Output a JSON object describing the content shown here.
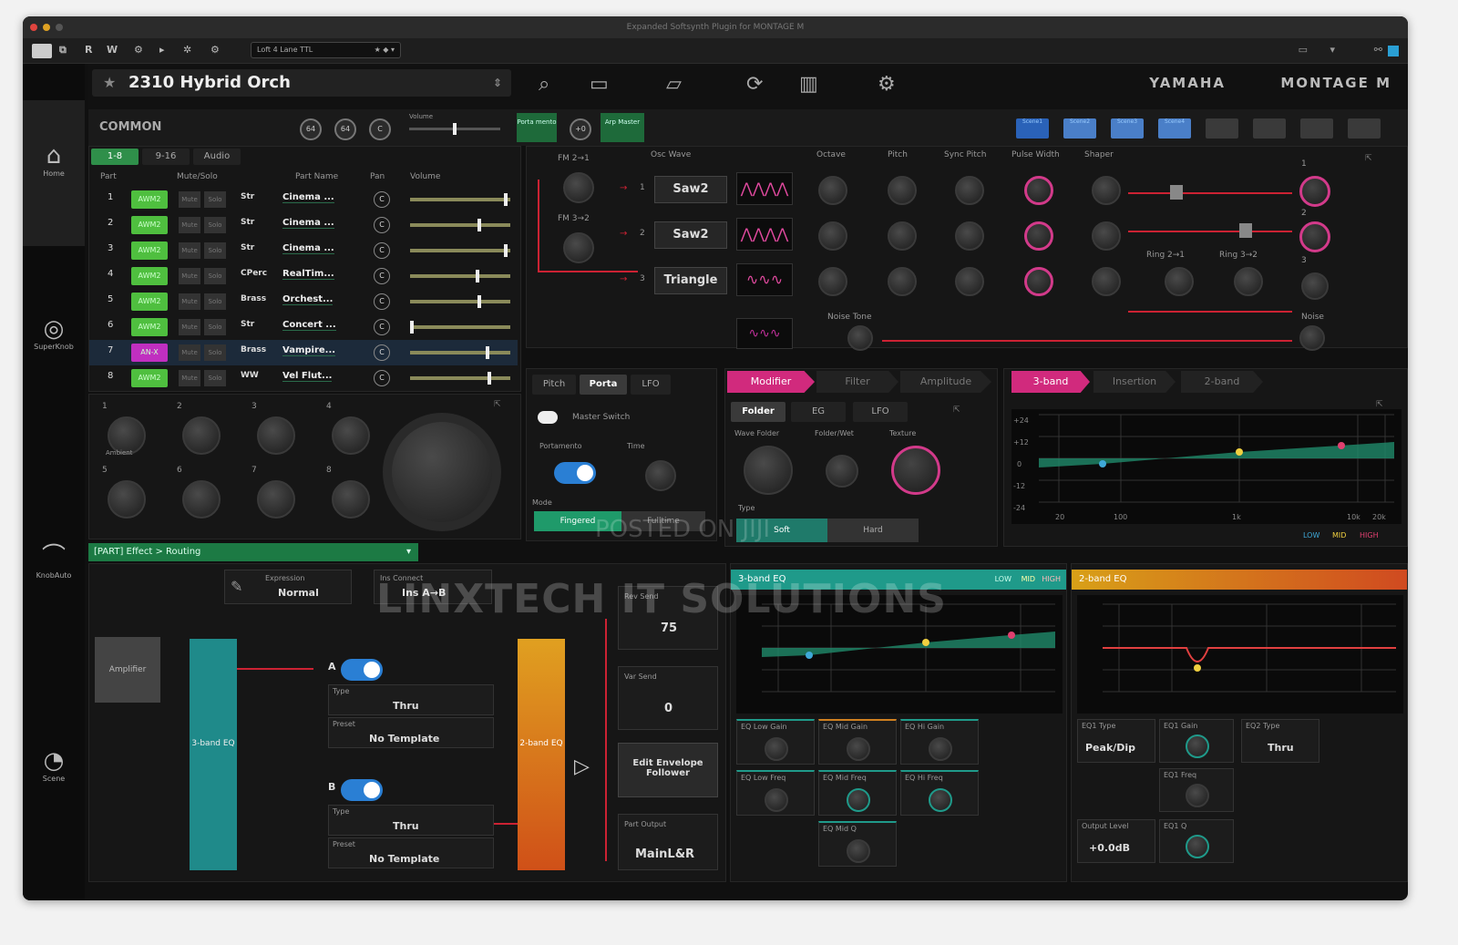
{
  "window": {
    "title": "Expanded Softsynth Plugin for MONTAGE M"
  },
  "toolbar": {
    "buttons": [
      "R",
      "W"
    ],
    "host_preset": "Loft 4 Lane TTL"
  },
  "header": {
    "preset_name": "2310 Hybrid Orch",
    "brand": "YAMAHA",
    "product": "MONTAGE M"
  },
  "sidebar": {
    "items": [
      "Home",
      "SuperKnob",
      "KnobAuto",
      "Scene"
    ]
  },
  "common": {
    "label": "COMMON",
    "pan": "64",
    "vol": "64",
    "porta_label": "Porta mento",
    "porta_value": "+0",
    "arp_label": "Arp Master",
    "vol_label": "Volume",
    "scenes": [
      "Scene1",
      "Scene2",
      "Scene3",
      "Scene4"
    ]
  },
  "parts": {
    "tabs": [
      "1-8",
      "9-16",
      "Audio"
    ],
    "headers": [
      "Part",
      "Mute/Solo",
      "Part Name",
      "Pan",
      "Volume"
    ],
    "rows": [
      {
        "num": "1",
        "type": "AWM2",
        "cat": "Str",
        "name": "Cinema ...",
        "pan": "C",
        "vol": 0.97
      },
      {
        "num": "2",
        "type": "AWM2",
        "cat": "Str",
        "name": "Cinema ...",
        "pan": "C",
        "vol": 0.7
      },
      {
        "num": "3",
        "type": "AWM2",
        "cat": "Str",
        "name": "Cinema ...",
        "pan": "C",
        "vol": 0.97
      },
      {
        "num": "4",
        "type": "AWM2",
        "cat": "CPerc",
        "name": "RealTim...",
        "pan": "C",
        "vol": 0.68
      },
      {
        "num": "5",
        "type": "AWM2",
        "cat": "Brass",
        "name": "Orchest...",
        "pan": "C",
        "vol": 0.7
      },
      {
        "num": "6",
        "type": "AWM2",
        "cat": "Str",
        "name": "Concert ...",
        "pan": "C",
        "vol": 0.0
      },
      {
        "num": "7",
        "type": "AN-X",
        "cat": "Brass",
        "name": "Vampire...",
        "pan": "C",
        "vol": 0.78
      },
      {
        "num": "8",
        "type": "AWM2",
        "cat": "WW",
        "name": "Vel Flut...",
        "pan": "C",
        "vol": 0.8
      }
    ],
    "mute": "Mute",
    "solo": "Solo"
  },
  "assign": {
    "knobs": [
      "1",
      "2",
      "3",
      "4",
      "5",
      "6",
      "7",
      "8"
    ],
    "knob1_label": "Ambient"
  },
  "osc": {
    "fm_labels": [
      "FM 2→1",
      "FM 3→2"
    ],
    "headers": [
      "Osc Wave",
      "Octave",
      "Pitch",
      "Sync Pitch",
      "Pulse Width",
      "Shaper"
    ],
    "osc_nums": [
      "1",
      "2",
      "3"
    ],
    "waves": [
      "Saw2",
      "Saw2",
      "Triangle"
    ],
    "ring_labels": [
      "Ring 2→1",
      "Ring 3→2"
    ],
    "noise_tone": "Noise Tone",
    "noise": "Noise",
    "out_nums": [
      "1",
      "2",
      "3"
    ]
  },
  "pitch_panel": {
    "tabs": [
      "Pitch",
      "Porta",
      "LFO"
    ],
    "master_switch": "Master Switch",
    "portamento": "Portamento",
    "time": "Time",
    "mode": "Mode",
    "mode_values": [
      "Fingered",
      "Fulltime"
    ]
  },
  "mod_panel": {
    "tabs": [
      "Modifier",
      "Filter",
      "Amplitude"
    ],
    "subtabs": [
      "Folder",
      "EG",
      "LFO"
    ],
    "labels": [
      "Wave Folder",
      "Folder/Wet",
      "Texture"
    ],
    "type_label": "Type",
    "types": [
      "Soft",
      "Hard"
    ]
  },
  "eq_top": {
    "tabs": [
      "3-band",
      "Insertion",
      "2-band"
    ],
    "y_ticks": [
      "+24",
      "+12",
      "0",
      "-12",
      "-24"
    ],
    "x_ticks": [
      "20",
      "100",
      "1k",
      "10k",
      "20k"
    ],
    "legend": [
      "LOW",
      "MID",
      "HIGH"
    ]
  },
  "routing": {
    "bar": "[PART] Effect > Routing",
    "expression_label": "Expression",
    "expression": "Normal",
    "ins_connect_label": "Ins Connect",
    "ins_connect": "Ins A→B",
    "rev_send_label": "Rev Send",
    "rev_send": "75",
    "var_send_label": "Var Send",
    "var_send": "0",
    "amplifier": "Amplifier",
    "eq3": "3-band EQ",
    "eq2": "2-band EQ",
    "insA": {
      "letter": "A",
      "type_label": "Type",
      "type": "Thru",
      "preset_label": "Preset",
      "preset": "No Template"
    },
    "insB": {
      "letter": "B",
      "type_label": "Type",
      "type": "Thru",
      "preset_label": "Preset",
      "preset": "No Template"
    },
    "env_follower": "Edit Envelope Follower",
    "part_output_label": "Part Output",
    "part_output": "MainL&R"
  },
  "eq3": {
    "title": "3-band EQ",
    "legend": [
      "LOW",
      "MID",
      "HIGH"
    ],
    "params": [
      "EQ Low Gain",
      "EQ Mid Gain",
      "EQ Hi Gain",
      "EQ Low Freq",
      "EQ Mid Freq",
      "EQ Hi Freq",
      "EQ Mid Q"
    ]
  },
  "eq2": {
    "title": "2-band EQ",
    "eq1_type_label": "EQ1 Type",
    "eq1_type": "Peak/Dip",
    "eq1_gain": "EQ1 Gain",
    "eq2_type_label": "EQ2 Type",
    "eq2_type": "Thru",
    "eq1_freq": "EQ1 Freq",
    "output_label": "Output Level",
    "output": "+0.0dB",
    "eq1_q": "EQ1 Q"
  },
  "watermark": {
    "line1": "POSTED ON JIJI",
    "line2": "LINXTECH IT SOLUTIONS"
  },
  "colors": {
    "accent_pink": "#d12a7d",
    "green": "#2f8f4a",
    "teal": "#1f9a8a",
    "orange": "#e07a20"
  }
}
